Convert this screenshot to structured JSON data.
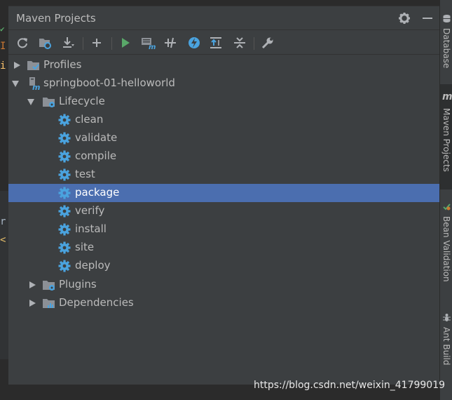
{
  "panel": {
    "title": "Maven Projects"
  },
  "tree": {
    "profiles": "Profiles",
    "project": "springboot-01-helloworld",
    "lifecycle": "Lifecycle",
    "goals": [
      "clean",
      "validate",
      "compile",
      "test",
      "package",
      "verify",
      "install",
      "site",
      "deploy"
    ],
    "selected_goal": "package",
    "plugins": "Plugins",
    "dependencies": "Dependencies"
  },
  "right_tabs": {
    "database": "Database",
    "maven_icon": "m",
    "maven": "Maven Projects",
    "bean": "Bean Validation",
    "ant": "Ant Build"
  },
  "editor_glyphs": [
    "I",
    "i",
    "r",
    "<"
  ],
  "watermark": "https://blog.csdn.net/weixin_41799019",
  "colors": {
    "selection": "#4b6eaf",
    "panel_bg": "#3c3f41",
    "run_green": "#59a869",
    "gear_blue": "#4aa3df",
    "folder_gray": "#8c9096"
  }
}
